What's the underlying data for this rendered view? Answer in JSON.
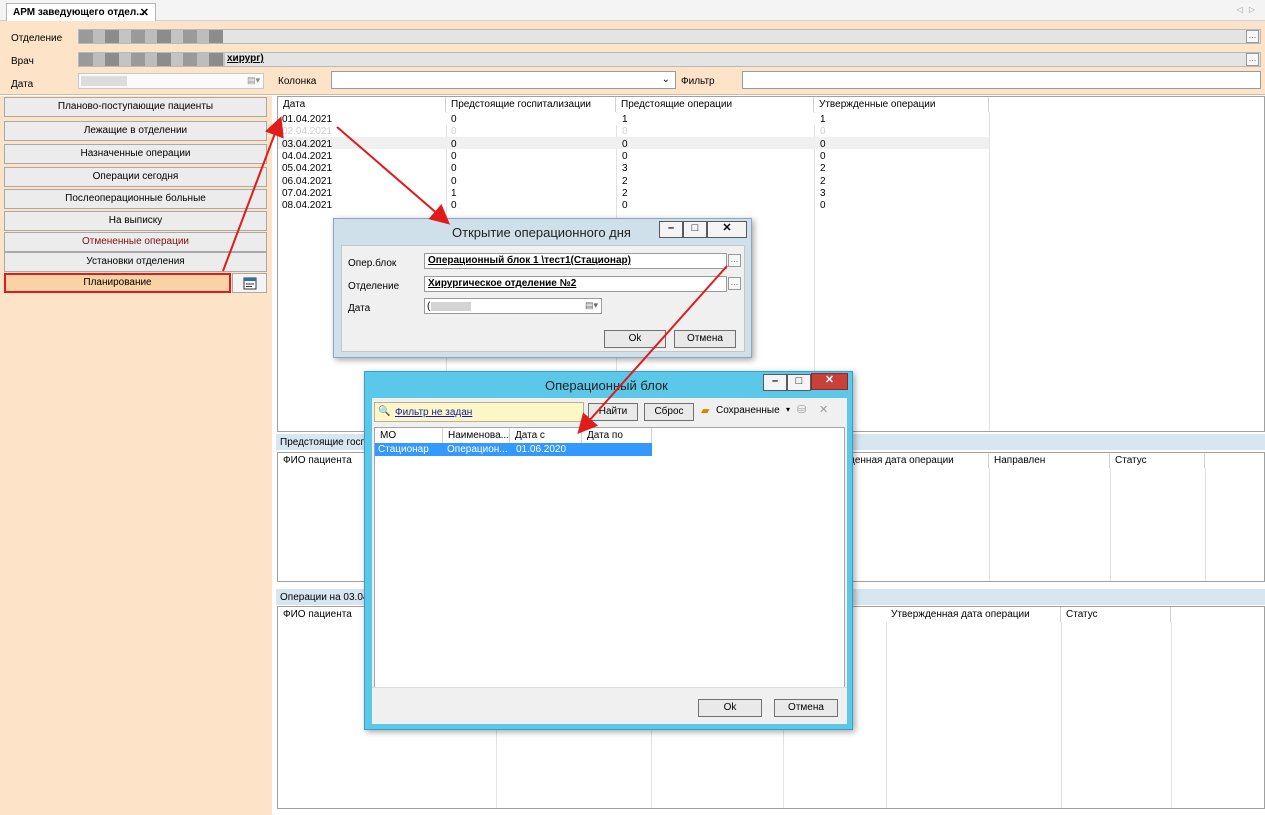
{
  "tab": {
    "title": "АРМ заведующего отдел...",
    "close": "✕",
    "nav": "◁ ▷"
  },
  "header": {
    "department_label": "Отделение",
    "doctor_label": "Врач",
    "doctor_suffix": "хирург)",
    "date_label": "Дата",
    "column_label": "Колонка",
    "column_value": "",
    "filter_label": "Фильтр",
    "filter_value": ""
  },
  "menu": [
    {
      "label": "Планово-поступающие пациенты"
    },
    {
      "label": "Лежащие в отделении"
    },
    {
      "label": "Назначенные операции"
    },
    {
      "label": "Операции сегодня"
    },
    {
      "label": "Послеоперационные больные"
    },
    {
      "label": "На выписку"
    },
    {
      "label": "Отмененные операции"
    },
    {
      "label": "Установки отделения"
    },
    {
      "label": "Планирование"
    }
  ],
  "main_grid": {
    "headers": [
      "Дата",
      "Предстоящие госпитализации",
      "Предстоящие операции",
      "Утвержденные операции"
    ],
    "rows": [
      [
        "01.04.2021",
        "0",
        "1",
        "1"
      ],
      [
        "02.04.2021",
        "0",
        "0",
        "0"
      ],
      [
        "03.04.2021",
        "0",
        "0",
        "0"
      ],
      [
        "04.04.2021",
        "0",
        "0",
        "0"
      ],
      [
        "05.04.2021",
        "0",
        "3",
        "2"
      ],
      [
        "06.04.2021",
        "0",
        "2",
        "2"
      ],
      [
        "07.04.2021",
        "1",
        "2",
        "3"
      ],
      [
        "08.04.2021",
        "0",
        "0",
        "0"
      ]
    ]
  },
  "upcoming_section": {
    "title": "Предстоящие госпи",
    "headers": [
      "ФИО пациента",
      "денная дата операции",
      "Направлен",
      "Статус"
    ]
  },
  "operations_section": {
    "title": "Операции на 03.04.",
    "headers": [
      "ФИО пациента",
      "Утвержденная дата операции",
      "Статус"
    ]
  },
  "dialog_open_day": {
    "title": "Открытие операционного дня",
    "block_label": "Опер.блок",
    "block_value": "Операционный блок 1 \\тест1(Стационар)",
    "dept_label": "Отделение",
    "dept_value": "Хирургическое отделение №2",
    "date_label": "Дата",
    "date_value": "(",
    "ok": "Ok",
    "cancel": "Отмена"
  },
  "dialog_block": {
    "title": "Операционный блок",
    "filter_link": "Фильтр не задан",
    "find": "Найти",
    "reset": "Сброс",
    "saved": "Сохраненные",
    "headers": [
      "МО",
      "Наименова...",
      "Дата с",
      "Дата по"
    ],
    "row": [
      "Стационар",
      "Операцион...",
      "01.06.2020",
      ""
    ],
    "ok": "Ok",
    "cancel": "Отмена"
  },
  "colors": {
    "accent_red": "#e01b1b",
    "header_bg": "#fde4c9",
    "selection": "#3399ff",
    "dialog_title_bg": "#5bc8ea"
  }
}
